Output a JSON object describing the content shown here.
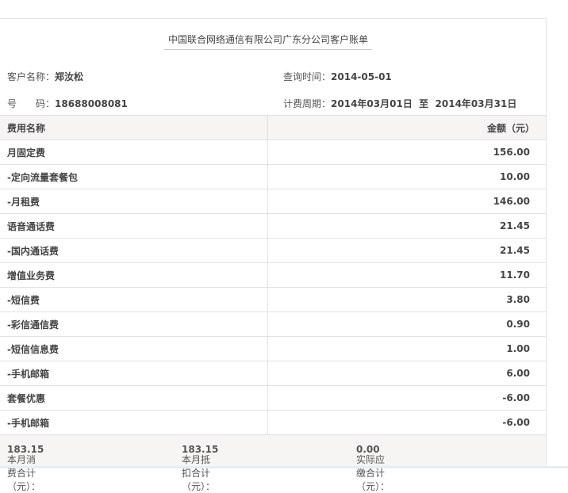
{
  "title": "中国联合网络通信有限公司广东分公司客户账单",
  "customer": {
    "name_label": "客户名称：",
    "name": "郑汝松",
    "query_label": "查询时间：",
    "query_time": "2014-05-01",
    "phone_label": "号　　码：",
    "phone": "18688008081",
    "period_label": "计费周期：",
    "period": "2014年03月01日  至  2014年03月31日"
  },
  "table": {
    "headers": [
      "费用名称",
      "金额（元）"
    ],
    "rows": [
      {
        "name": "月固定费",
        "amount": "156.00"
      },
      {
        "name": "-定向流量套餐包",
        "amount": "10.00"
      },
      {
        "name": "-月租费",
        "amount": "146.00"
      },
      {
        "name": "语音通话费",
        "amount": "21.45"
      },
      {
        "name": "-国内通话费",
        "amount": "21.45"
      },
      {
        "name": "增值业务费",
        "amount": "11.70"
      },
      {
        "name": "-短信费",
        "amount": "3.80"
      },
      {
        "name": "-彩信通信费",
        "amount": "0.90"
      },
      {
        "name": "-短信信息费",
        "amount": "1.00"
      },
      {
        "name": "-手机邮箱",
        "amount": "6.00"
      },
      {
        "name": "套餐优惠",
        "amount": "-6.00"
      },
      {
        "name": "-手机邮箱",
        "amount": "-6.00"
      }
    ]
  },
  "footer": {
    "consume_label": "本月消费合计（元）：",
    "consume": "183.15",
    "deduct_label": "本月抵扣合计（元）：",
    "deduct": "183.15",
    "due_label": "实际应缴合计（元）：",
    "due": "0.00"
  }
}
